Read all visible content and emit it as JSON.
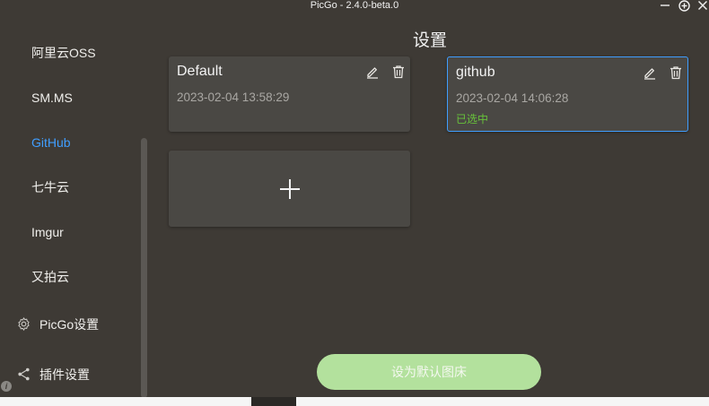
{
  "window": {
    "title": "PicGo - 2.4.0-beta.0",
    "controls": {
      "minimize": "—",
      "maximize": "⊕",
      "close": "✕"
    }
  },
  "sidebar": {
    "items": [
      {
        "label": "阿里云OSS",
        "active": false
      },
      {
        "label": "SM.MS",
        "active": false
      },
      {
        "label": "GitHub",
        "active": true
      },
      {
        "label": "七牛云",
        "active": false
      },
      {
        "label": "Imgur",
        "active": false
      },
      {
        "label": "又拍云",
        "active": false
      }
    ],
    "menu": [
      {
        "label": "PicGo设置",
        "icon": "gear-icon"
      },
      {
        "label": "插件设置",
        "icon": "share-icon"
      }
    ],
    "info_icon": "i"
  },
  "main": {
    "title": "设置",
    "cards": [
      {
        "name": "Default",
        "date": "2023-02-04 13:58:29",
        "status": ""
      },
      {
        "name": "github",
        "date": "2023-02-04 14:06:28",
        "status": "已选中"
      }
    ],
    "add_label": "+",
    "default_button": "设为默认图床"
  },
  "colors": {
    "background": "#3e3a35",
    "card": "#4a4844",
    "accent": "#409eff",
    "selected_status": "#67c23a",
    "button": "#b3e19d"
  }
}
